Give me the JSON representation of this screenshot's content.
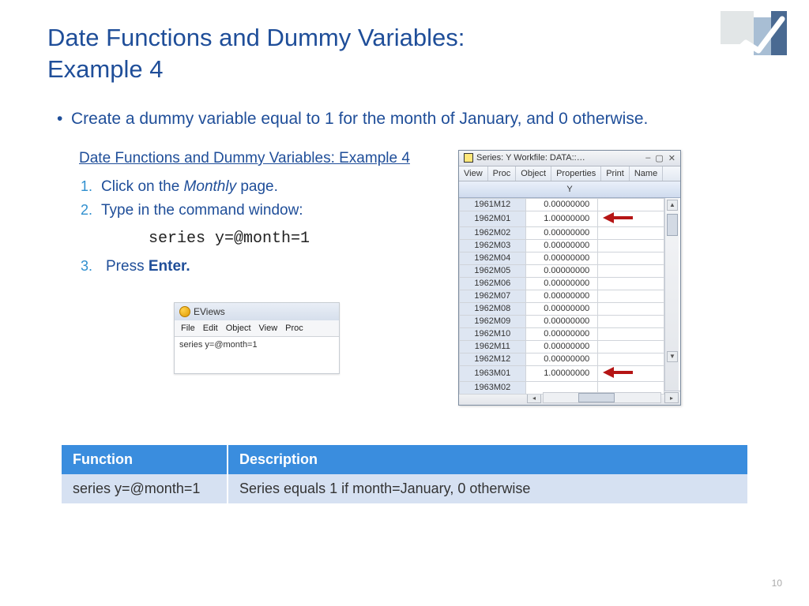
{
  "title_line1": "Date Functions and Dummy Variables:",
  "title_line2": "Example 4",
  "main_bullet": "Create a dummy variable equal to 1 for the month of January, and 0 otherwise.",
  "subhead": "Date Functions and Dummy Variables: Example 4",
  "steps": {
    "s1_pre": "Click on the ",
    "s1_em": "Monthly",
    "s1_post": " page.",
    "s2": "Type in the command window:",
    "code": "series y=@month=1",
    "s3_pre": "Press ",
    "s3_bold": "Enter."
  },
  "cmdwin": {
    "title": "EViews",
    "menus": [
      "File",
      "Edit",
      "Object",
      "View",
      "Proc"
    ],
    "cmd": "series y=@month=1"
  },
  "serieswin": {
    "title": "Series: Y   Workfile: DATA::…",
    "toolbar": [
      "View",
      "Proc",
      "Object",
      "Properties",
      "Print",
      "Name"
    ],
    "col": "Y",
    "rows": [
      {
        "d": "1961M12",
        "v": "0.00000000",
        "arrow": false
      },
      {
        "d": "1962M01",
        "v": "1.00000000",
        "arrow": true
      },
      {
        "d": "1962M02",
        "v": "0.00000000",
        "arrow": false
      },
      {
        "d": "1962M03",
        "v": "0.00000000",
        "arrow": false
      },
      {
        "d": "1962M04",
        "v": "0.00000000",
        "arrow": false
      },
      {
        "d": "1962M05",
        "v": "0.00000000",
        "arrow": false
      },
      {
        "d": "1962M06",
        "v": "0.00000000",
        "arrow": false
      },
      {
        "d": "1962M07",
        "v": "0.00000000",
        "arrow": false
      },
      {
        "d": "1962M08",
        "v": "0.00000000",
        "arrow": false
      },
      {
        "d": "1962M09",
        "v": "0.00000000",
        "arrow": false
      },
      {
        "d": "1962M10",
        "v": "0.00000000",
        "arrow": false
      },
      {
        "d": "1962M11",
        "v": "0.00000000",
        "arrow": false
      },
      {
        "d": "1962M12",
        "v": "0.00000000",
        "arrow": false
      },
      {
        "d": "1963M01",
        "v": "1.00000000",
        "arrow": true
      },
      {
        "d": "1963M02",
        "v": "",
        "arrow": false
      }
    ]
  },
  "func_table": {
    "h1": "Function",
    "h2": "Description",
    "c1": "series y=@month=1",
    "c2": "Series equals 1 if month=January, 0 otherwise"
  },
  "page_num": "10"
}
